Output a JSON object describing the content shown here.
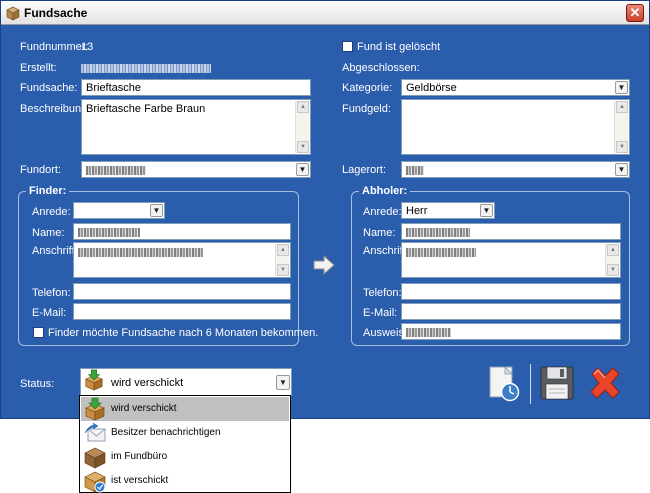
{
  "window": {
    "title": "Fundsache"
  },
  "left": {
    "fundnummer_label": "Fundnummer:",
    "fundnummer_value": "13",
    "erstellt_label": "Erstellt:",
    "fundsache_label": "Fundsache:",
    "fundsache_value": "Brieftasche",
    "beschreibung_label": "Beschreibung:",
    "beschreibung_value": "Brieftasche Farbe Braun",
    "fundort_label": "Fundort:"
  },
  "right": {
    "geloescht_label": "Fund ist gelöscht",
    "abgeschlossen_label": "Abgeschlossen:",
    "kategorie_label": "Kategorie:",
    "kategorie_value": "Geldbörse",
    "fundgeld_label": "Fundgeld:",
    "lagerort_label": "Lagerort:"
  },
  "finder": {
    "title": "Finder:",
    "anrede_label": "Anrede:",
    "anrede_value": "",
    "name_label": "Name:",
    "anschrift_label": "Anschrift:",
    "telefon_label": "Telefon:",
    "email_label": "E-Mail:",
    "checkbox_label": "Finder möchte Fundsache nach 6 Monaten bekommen."
  },
  "abholer": {
    "title": "Abholer:",
    "anrede_label": "Anrede:",
    "anrede_value": "Herr",
    "name_label": "Name:",
    "anschrift_label": "Anschrift:",
    "telefon_label": "Telefon:",
    "email_label": "E-Mail:",
    "ausweis_label": "Ausweis:"
  },
  "status": {
    "label": "Status:",
    "value": "wird verschickt",
    "options": [
      "wird verschickt",
      "Besitzer benachrichtigen",
      "im Fundbüro",
      "ist verschickt"
    ]
  },
  "icons": {
    "title": "box-icon",
    "transfer": "arrow-right-icon",
    "history": "clock-document-icon",
    "save": "floppy-disk-icon",
    "cancel": "red-x-icon"
  }
}
